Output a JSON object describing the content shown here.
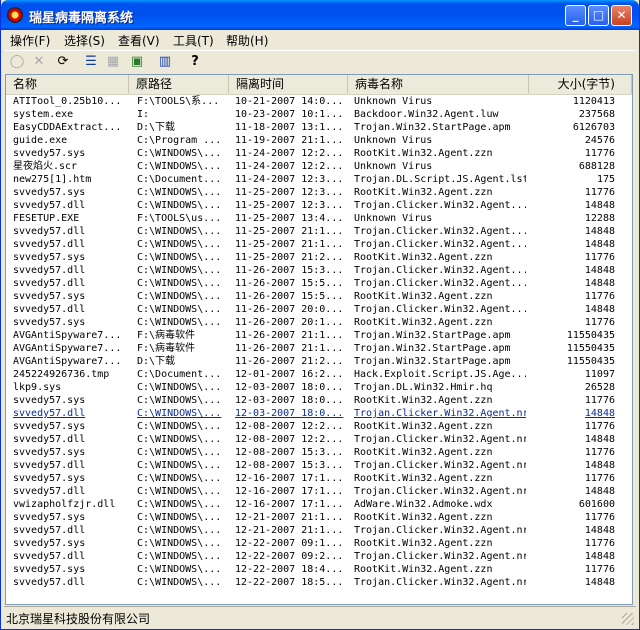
{
  "window": {
    "title": "瑞星病毒隔离系统",
    "minimize": "_",
    "maximize": "□",
    "close": "✕"
  },
  "menu": [
    {
      "label": "操作(F)"
    },
    {
      "label": "选择(S)"
    },
    {
      "label": "查看(V)"
    },
    {
      "label": "工具(T)"
    },
    {
      "label": "帮助(H)"
    }
  ],
  "toolbar": {
    "icons": [
      "restore-icon",
      "delete-icon",
      "scan-icon",
      "large-icons-view-icon",
      "list-view-icon",
      "refresh-icon",
      "stats-chart-icon",
      "help-icon"
    ],
    "glyphs": [
      "◯",
      "✕",
      "⟳",
      "☰",
      "▦",
      "▣",
      "▥",
      "?"
    ]
  },
  "columns": [
    {
      "label": "名称"
    },
    {
      "label": "原路径"
    },
    {
      "label": "隔离时间"
    },
    {
      "label": "病毒名称"
    },
    {
      "label": "大小(字节)"
    }
  ],
  "rows": [
    {
      "name": "ATITool_0.25b10...",
      "path": "F:\\TOOLS\\系...",
      "time": "10-21-2007 14:0...",
      "virus": "Unknown Virus",
      "size": "1120413"
    },
    {
      "name": "system.exe",
      "path": "I:",
      "time": "10-23-2007 10:1...",
      "virus": "Backdoor.Win32.Agent.luw",
      "size": "237568"
    },
    {
      "name": "EasyCDDAExtract...",
      "path": "D:\\下载",
      "time": "11-18-2007 13:1...",
      "virus": "Trojan.Win32.StartPage.apm",
      "size": "6126703"
    },
    {
      "name": "guide.exe",
      "path": "C:\\Program ...",
      "time": "11-19-2007 21:1...",
      "virus": "Unknown Virus",
      "size": "24576"
    },
    {
      "name": "svvedy57.sys",
      "path": "C:\\WINDOWS\\...",
      "time": "11-24-2007 12:2...",
      "virus": "RootKit.Win32.Agent.zzn",
      "size": "11776"
    },
    {
      "name": "星夜焰火.scr",
      "path": "C:\\WINDOWS\\...",
      "time": "11-24-2007 12:2...",
      "virus": "Unknown Virus",
      "size": "688128"
    },
    {
      "name": "new275[1].htm",
      "path": "C:\\Document...",
      "time": "11-24-2007 12:3...",
      "virus": "Trojan.DL.Script.JS.Agent.lst",
      "size": "175"
    },
    {
      "name": "svvedy57.sys",
      "path": "C:\\WINDOWS\\...",
      "time": "11-25-2007 12:3...",
      "virus": "RootKit.Win32.Agent.zzn",
      "size": "11776"
    },
    {
      "name": "svvedy57.dll",
      "path": "C:\\WINDOWS\\...",
      "time": "11-25-2007 12:3...",
      "virus": "Trojan.Clicker.Win32.Agent...",
      "size": "14848"
    },
    {
      "name": "FESETUP.EXE",
      "path": "F:\\TOOLS\\us...",
      "time": "11-25-2007 13:4...",
      "virus": "Unknown Virus",
      "size": "12288"
    },
    {
      "name": "svvedy57.dll",
      "path": "C:\\WINDOWS\\...",
      "time": "11-25-2007 21:1...",
      "virus": "Trojan.Clicker.Win32.Agent...",
      "size": "14848"
    },
    {
      "name": "svvedy57.dll",
      "path": "C:\\WINDOWS\\...",
      "time": "11-25-2007 21:1...",
      "virus": "Trojan.Clicker.Win32.Agent...",
      "size": "14848"
    },
    {
      "name": "svvedy57.sys",
      "path": "C:\\WINDOWS\\...",
      "time": "11-25-2007 21:2...",
      "virus": "RootKit.Win32.Agent.zzn",
      "size": "11776"
    },
    {
      "name": "svvedy57.dll",
      "path": "C:\\WINDOWS\\...",
      "time": "11-26-2007 15:3...",
      "virus": "Trojan.Clicker.Win32.Agent...",
      "size": "14848"
    },
    {
      "name": "svvedy57.dll",
      "path": "C:\\WINDOWS\\...",
      "time": "11-26-2007 15:5...",
      "virus": "Trojan.Clicker.Win32.Agent...",
      "size": "14848"
    },
    {
      "name": "svvedy57.sys",
      "path": "C:\\WINDOWS\\...",
      "time": "11-26-2007 15:5...",
      "virus": "RootKit.Win32.Agent.zzn",
      "size": "11776"
    },
    {
      "name": "svvedy57.dll",
      "path": "C:\\WINDOWS\\...",
      "time": "11-26-2007 20:0...",
      "virus": "Trojan.Clicker.Win32.Agent...",
      "size": "14848"
    },
    {
      "name": "svvedy57.sys",
      "path": "C:\\WINDOWS\\...",
      "time": "11-26-2007 20:1...",
      "virus": "RootKit.Win32.Agent.zzn",
      "size": "11776"
    },
    {
      "name": "AVGAntiSpyware7...",
      "path": "F:\\病毒软件",
      "time": "11-26-2007 21:1...",
      "virus": "Trojan.Win32.StartPage.apm",
      "size": "11550435"
    },
    {
      "name": "AVGAntiSpyware7...",
      "path": "F:\\病毒软件",
      "time": "11-26-2007 21:1...",
      "virus": "Trojan.Win32.StartPage.apm",
      "size": "11550435"
    },
    {
      "name": "AVGAntiSpyware7...",
      "path": "D:\\下载",
      "time": "11-26-2007 21:2...",
      "virus": "Trojan.Win32.StartPage.apm",
      "size": "11550435"
    },
    {
      "name": "245224926736.tmp",
      "path": "C:\\Document...",
      "time": "12-01-2007 16:2...",
      "virus": "Hack.Exploit.Script.JS.Age...",
      "size": "11097"
    },
    {
      "name": "lkp9.sys",
      "path": "C:\\WINDOWS\\...",
      "time": "12-03-2007 18:0...",
      "virus": "Trojan.DL.Win32.Hmir.hq",
      "size": "26528"
    },
    {
      "name": "svvedy57.sys",
      "path": "C:\\WINDOWS\\...",
      "time": "12-03-2007 18:0...",
      "virus": "RootKit.Win32.Agent.zzn",
      "size": "11776"
    },
    {
      "name": "svvedy57.dll",
      "path": "C:\\WINDOWS\\...",
      "time": "12-03-2007 18:0...",
      "virus": "Trojan.Clicker.Win32.Agent.nr",
      "size": "14848",
      "selected": true
    },
    {
      "name": "svvedy57.sys",
      "path": "C:\\WINDOWS\\...",
      "time": "12-08-2007 12:2...",
      "virus": "RootKit.Win32.Agent.zzn",
      "size": "11776"
    },
    {
      "name": "svvedy57.dll",
      "path": "C:\\WINDOWS\\...",
      "time": "12-08-2007 12:2...",
      "virus": "Trojan.Clicker.Win32.Agent.nr",
      "size": "14848"
    },
    {
      "name": "svvedy57.sys",
      "path": "C:\\WINDOWS\\...",
      "time": "12-08-2007 15:3...",
      "virus": "RootKit.Win32.Agent.zzn",
      "size": "11776"
    },
    {
      "name": "svvedy57.dll",
      "path": "C:\\WINDOWS\\...",
      "time": "12-08-2007 15:3...",
      "virus": "Trojan.Clicker.Win32.Agent.nr",
      "size": "14848"
    },
    {
      "name": "svvedy57.sys",
      "path": "C:\\WINDOWS\\...",
      "time": "12-16-2007 17:1...",
      "virus": "RootKit.Win32.Agent.zzn",
      "size": "11776"
    },
    {
      "name": "svvedy57.dll",
      "path": "C:\\WINDOWS\\...",
      "time": "12-16-2007 17:1...",
      "virus": "Trojan.Clicker.Win32.Agent.nr",
      "size": "14848"
    },
    {
      "name": "vwizapholfzjr.dll",
      "path": "C:\\WINDOWS\\...",
      "time": "12-16-2007 17:1...",
      "virus": "AdWare.Win32.Admoke.wdx",
      "size": "601600"
    },
    {
      "name": "svvedy57.sys",
      "path": "C:\\WINDOWS\\...",
      "time": "12-21-2007 21:1...",
      "virus": "RootKit.Win32.Agent.zzn",
      "size": "11776"
    },
    {
      "name": "svvedy57.dll",
      "path": "C:\\WINDOWS\\...",
      "time": "12-21-2007 21:1...",
      "virus": "Trojan.Clicker.Win32.Agent.nr",
      "size": "14848"
    },
    {
      "name": "svvedy57.sys",
      "path": "C:\\WINDOWS\\...",
      "time": "12-22-2007 09:1...",
      "virus": "RootKit.Win32.Agent.zzn",
      "size": "11776"
    },
    {
      "name": "svvedy57.dll",
      "path": "C:\\WINDOWS\\...",
      "time": "12-22-2007 09:2...",
      "virus": "Trojan.Clicker.Win32.Agent.nr",
      "size": "14848"
    },
    {
      "name": "svvedy57.sys",
      "path": "C:\\WINDOWS\\...",
      "time": "12-22-2007 18:4...",
      "virus": "RootKit.Win32.Agent.zzn",
      "size": "11776"
    },
    {
      "name": "svvedy57.dll",
      "path": "C:\\WINDOWS\\...",
      "time": "12-22-2007 18:5...",
      "virus": "Trojan.Clicker.Win32.Agent.nr",
      "size": "14848"
    }
  ],
  "status": {
    "text": "北京瑞星科技股份有限公司"
  }
}
